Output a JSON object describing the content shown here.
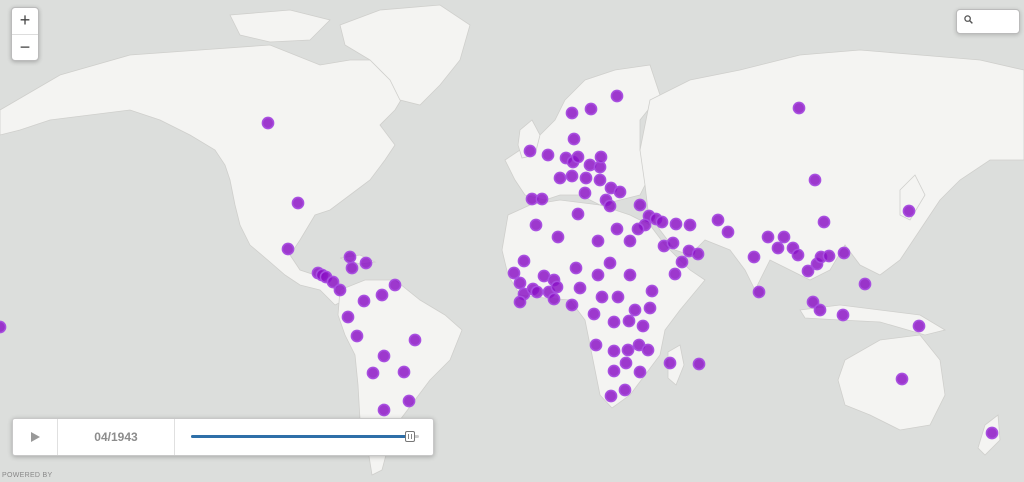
{
  "map": {
    "zoom_in_label": "+",
    "zoom_out_label": "−",
    "search_placeholder": "",
    "attribution": "POWERED BY"
  },
  "timeline": {
    "date": "04/1943",
    "progress": 0.96
  },
  "colors": {
    "ocean": "#dcdedc",
    "land": "#f4f4f2",
    "marker": "#8a0fc4",
    "slider_fill": "#2e6fa8"
  },
  "markers_count": 175
}
